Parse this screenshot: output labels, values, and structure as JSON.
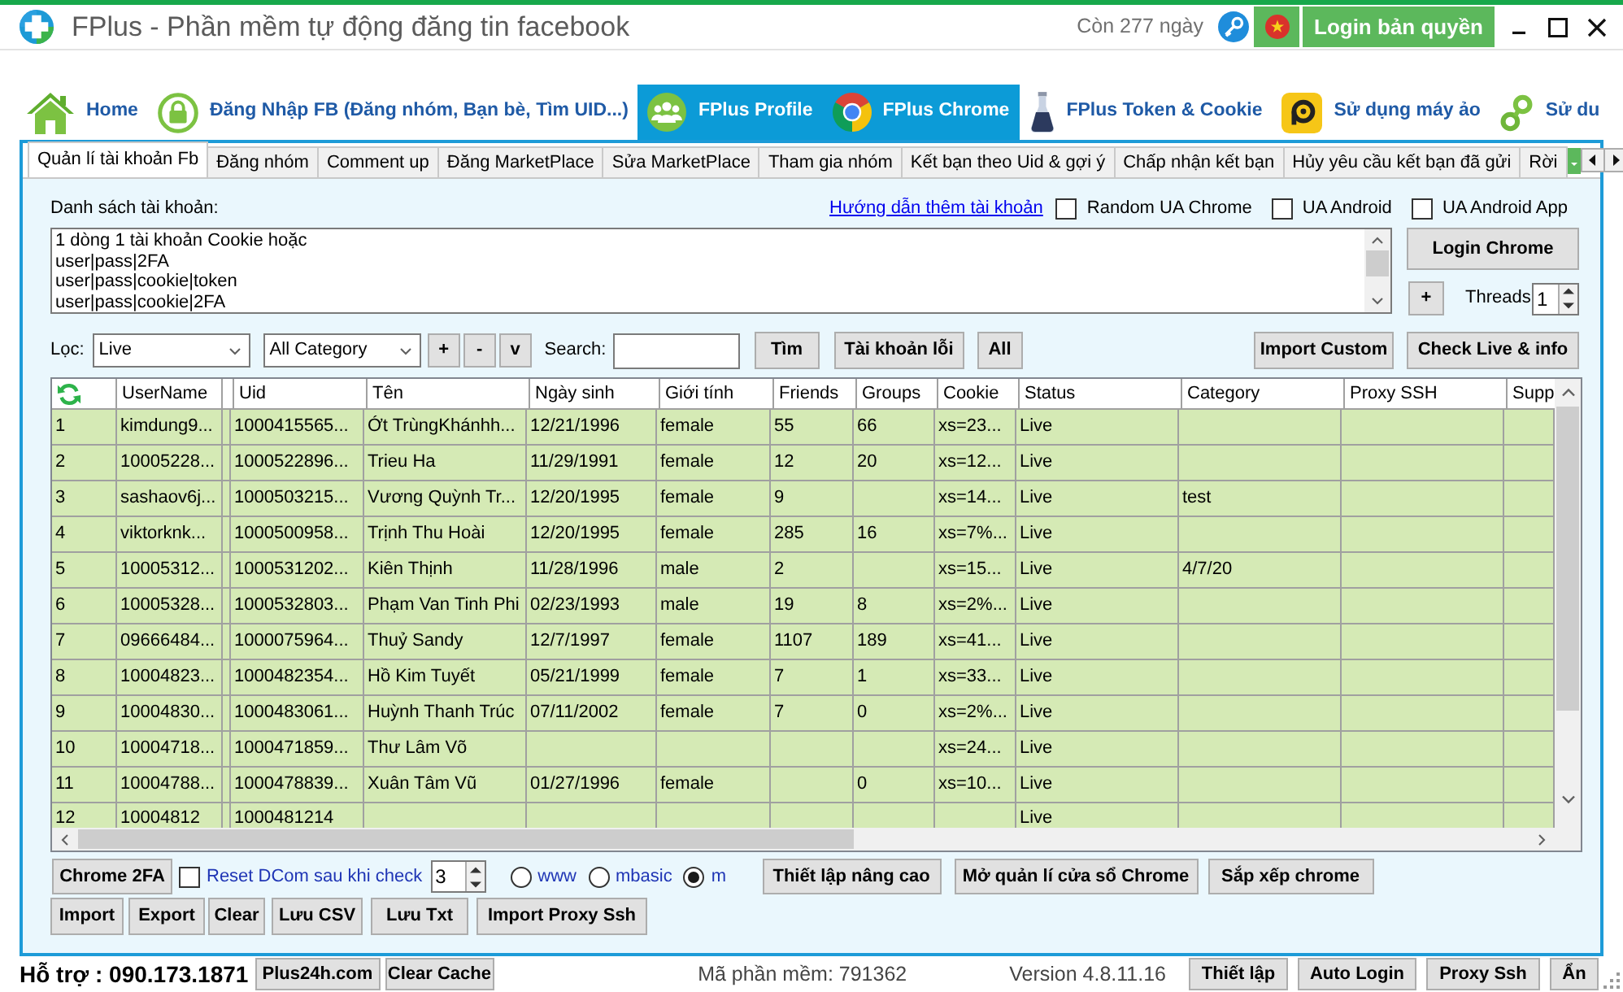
{
  "window": {
    "title": "FPlus - Phần mềm tự động đăng tin facebook",
    "license_days": "Còn 277 ngày",
    "login_button": "Login bản quyền"
  },
  "toolbar": [
    {
      "kind": "home",
      "label": "Home",
      "selected": false
    },
    {
      "kind": "lock",
      "label": "Đăng Nhập FB (Đăng nhóm, Bạn bè, Tìm UID...)",
      "selected": false
    },
    {
      "kind": "profile",
      "label": "FPlus Profile",
      "selected": true
    },
    {
      "kind": "chrome",
      "label": "FPlus Chrome",
      "selected": true
    },
    {
      "kind": "flask",
      "label": "FPlus Token & Cookie",
      "selected": false
    },
    {
      "kind": "emulator",
      "label": "Sử dụng máy ảo",
      "selected": false
    },
    {
      "kind": "chain",
      "label": "Sử du",
      "selected": false
    }
  ],
  "tabs": [
    {
      "label": "Quản lí tài khoản Fb",
      "selected": true
    },
    {
      "label": "Đăng nhóm",
      "selected": false
    },
    {
      "label": "Comment up",
      "selected": false
    },
    {
      "label": "Đăng MarketPlace",
      "selected": false
    },
    {
      "label": "Sửa MarketPlace",
      "selected": false
    },
    {
      "label": "Tham gia nhóm",
      "selected": false
    },
    {
      "label": "Kết bạn theo Uid & gợi ý",
      "selected": false
    },
    {
      "label": "Chấp nhận kết bạn",
      "selected": false
    },
    {
      "label": "Hủy yêu cầu kết bạn đã gửi",
      "selected": false
    },
    {
      "label": "Rời",
      "selected": false
    }
  ],
  "accounts": {
    "label": "Danh sách tài khoản:",
    "help_link": "Hướng dẫn thêm tài khoản",
    "options": [
      {
        "label": "Random UA Chrome",
        "checked": false
      },
      {
        "label": "UA Android",
        "checked": false
      },
      {
        "label": "UA Android App",
        "checked": false
      }
    ],
    "list": [
      "1 dòng 1 tài khoản Cookie hoặc",
      "user|pass|2FA",
      "user|pass|cookie|token",
      "user|pass|cookie|2FA"
    ],
    "login_button": "Login Chrome",
    "add_button": "+",
    "threads_label": "Threads",
    "threads": "1"
  },
  "filter": {
    "label": "Lọc:",
    "status": "Live",
    "category": "All Category",
    "small_buttons": [
      "+",
      "-",
      "v"
    ],
    "search_label": "Search:",
    "buttons": [
      "Tìm",
      "Tài khoản lỗi",
      "All"
    ],
    "right_buttons": [
      "Import Custom",
      "Check Live & info"
    ]
  },
  "table": {
    "columns": [
      "UserName",
      "Uid",
      "Tên",
      "Ngày sinh",
      "Giới tính",
      "Friends",
      "Groups",
      "Cookie",
      "Status",
      "Category",
      "Proxy SSH",
      "Supp"
    ],
    "rows": [
      {
        "no": "1",
        "username": "kimdung9...",
        "uid": "1000415565...",
        "name": "Ớt TrùngKhánhh...",
        "birthday": "12/21/1996",
        "gender": "female",
        "friends": "55",
        "groups": "66",
        "cookie": "xs=23...",
        "status": "Live"
      },
      {
        "no": "2",
        "username": "10005228...",
        "uid": "1000522896...",
        "name": "Trieu Ha",
        "birthday": "11/29/1991",
        "gender": "female",
        "friends": "12",
        "groups": "20",
        "cookie": "xs=12...",
        "status": "Live"
      },
      {
        "no": "3",
        "username": "sashaov6j...",
        "uid": "1000503215...",
        "name": "Vương Quỳnh Tr...",
        "birthday": "12/20/1995",
        "gender": "female",
        "friends": "9",
        "cookie": "xs=14...",
        "status": "Live",
        "category": "test"
      },
      {
        "no": "4",
        "username": "viktorknk...",
        "uid": "1000500958...",
        "name": "Trịnh Thu Hoài",
        "birthday": "12/20/1995",
        "gender": "female",
        "friends": "285",
        "groups": "16",
        "cookie": "xs=7%...",
        "status": "Live"
      },
      {
        "no": "5",
        "username": "10005312...",
        "uid": "1000531202...",
        "name": "Kiên Thịnh",
        "birthday": "11/28/1996",
        "gender": "male",
        "friends": "2",
        "cookie": "xs=15...",
        "status": "Live",
        "category": "4/7/20"
      },
      {
        "no": "6",
        "username": "10005328...",
        "uid": "1000532803...",
        "name": "Phạm Van Tinh Phi",
        "birthday": "02/23/1993",
        "gender": "male",
        "friends": "19",
        "groups": "8",
        "cookie": "xs=2%...",
        "status": "Live"
      },
      {
        "no": "7",
        "username": "09666484...",
        "uid": "1000075964...",
        "name": "Thuỷ Sandy",
        "birthday": "12/7/1997",
        "gender": "female",
        "friends": "1107",
        "groups": "189",
        "cookie": "xs=41...",
        "status": "Live"
      },
      {
        "no": "8",
        "username": "10004823...",
        "uid": "1000482354...",
        "name": "Hồ Kim Tuyết",
        "birthday": "05/21/1999",
        "gender": "female",
        "friends": "7",
        "groups": "1",
        "cookie": "xs=33...",
        "status": "Live"
      },
      {
        "no": "9",
        "username": "10004830...",
        "uid": "1000483061...",
        "name": "Huỳnh Thanh Trúc",
        "birthday": "07/11/2002",
        "gender": "female",
        "friends": "7",
        "groups": "0",
        "cookie": "xs=2%...",
        "status": "Live"
      },
      {
        "no": "10",
        "username": "10004718...",
        "uid": "1000471859...",
        "name": "Thư Lâm Võ",
        "cookie": "xs=24...",
        "status": "Live"
      },
      {
        "no": "11",
        "username": "10004788...",
        "uid": "1000478839...",
        "name": "Xuân Tâm Vũ",
        "birthday": "01/27/1996",
        "gender": "female",
        "groups": "0",
        "cookie": "xs=10...",
        "status": "Live"
      },
      {
        "no": "12",
        "username": "10004812",
        "uid": "1000481214",
        "status": "Live"
      }
    ]
  },
  "chrome_bar": {
    "button": "Chrome 2FA",
    "reset_dcom": {
      "label": "Reset DCom sau khi check",
      "checked": false
    },
    "dcom": "3",
    "modes": [
      {
        "label": "www",
        "selected": false
      },
      {
        "label": "mbasic",
        "selected": false
      },
      {
        "label": "m",
        "selected": true
      }
    ],
    "buttons": [
      "Thiết lập nâng cao",
      "Mở quản lí cửa sổ Chrome",
      "Sắp xếp chrome"
    ]
  },
  "file_buttons": [
    "Import",
    "Export",
    "Clear",
    "Lưu CSV",
    "Lưu Txt",
    "Import Proxy Ssh"
  ],
  "status_bar": {
    "support": "Hỗ trợ : 090.173.1871",
    "links": [
      "Plus24h.com",
      "Clear Cache"
    ],
    "software_id": "Mã phần mềm: 791362",
    "version": "Version 4.8.11.16",
    "buttons": [
      "Thiết lập",
      "Auto Login",
      "Proxy Ssh",
      "Ẩn"
    ]
  }
}
